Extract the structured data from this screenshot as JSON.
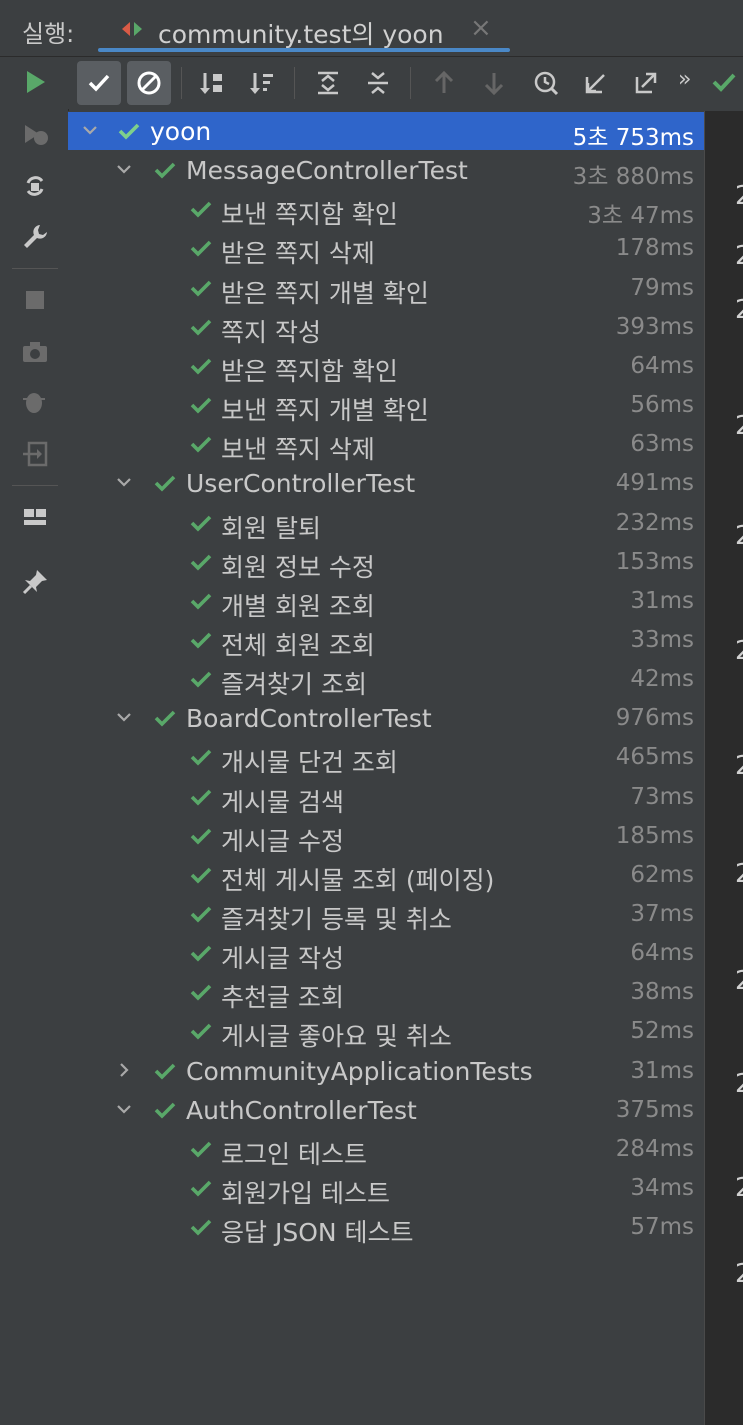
{
  "header": {
    "run_label": "실행:",
    "tab_title": "community.test의 yoon",
    "tab_close": "×"
  },
  "toolbar": {
    "more": "»"
  },
  "tree": {
    "root": {
      "label": "yoon",
      "time": "5초 753ms"
    },
    "suites": [
      {
        "label": "MessageControllerTest",
        "time": "3초 880ms",
        "expanded": true,
        "tests": [
          {
            "label": "보낸 쪽지함 확인",
            "time": "3초 47ms"
          },
          {
            "label": "받은 쪽지 삭제",
            "time": "178ms"
          },
          {
            "label": "받은 쪽지 개별 확인",
            "time": "79ms"
          },
          {
            "label": "쪽지 작성",
            "time": "393ms"
          },
          {
            "label": "받은 쪽지함 확인",
            "time": "64ms"
          },
          {
            "label": "보낸 쪽지 개별 확인",
            "time": "56ms"
          },
          {
            "label": "보낸 쪽지 삭제",
            "time": "63ms"
          }
        ]
      },
      {
        "label": "UserControllerTest",
        "time": "491ms",
        "expanded": true,
        "tests": [
          {
            "label": "회원 탈퇴",
            "time": "232ms"
          },
          {
            "label": "회원 정보 수정",
            "time": "153ms"
          },
          {
            "label": "개별 회원 조회",
            "time": "31ms"
          },
          {
            "label": "전체 회원 조회",
            "time": "33ms"
          },
          {
            "label": "즐겨찾기 조회",
            "time": "42ms"
          }
        ]
      },
      {
        "label": "BoardControllerTest",
        "time": "976ms",
        "expanded": true,
        "tests": [
          {
            "label": "개시물 단건 조회",
            "time": "465ms"
          },
          {
            "label": "게시물 검색",
            "time": "73ms"
          },
          {
            "label": "게시글 수정",
            "time": "185ms"
          },
          {
            "label": "전체 게시물 조회 (페이징)",
            "time": "62ms"
          },
          {
            "label": "즐겨찾기 등록 및 취소",
            "time": "37ms"
          },
          {
            "label": "게시글 작성",
            "time": "64ms"
          },
          {
            "label": "추천글 조회",
            "time": "38ms"
          },
          {
            "label": "게시글 좋아요 및 취소",
            "time": "52ms"
          }
        ]
      },
      {
        "label": "CommunityApplicationTests",
        "time": "31ms",
        "expanded": false,
        "tests": []
      },
      {
        "label": "AuthControllerTest",
        "time": "375ms",
        "expanded": true,
        "tests": [
          {
            "label": "로그인 테스트",
            "time": "284ms"
          },
          {
            "label": "회원가입 테스트",
            "time": "34ms"
          },
          {
            "label": "응답 JSON 테스트",
            "time": "57ms"
          }
        ]
      }
    ]
  },
  "console_lines": [
    "2",
    "2",
    "2",
    "2",
    "2",
    "2",
    "2",
    "2",
    "2",
    "2",
    "2",
    "2"
  ],
  "colors": {
    "accent": "#2f65ca",
    "check": "#59a869",
    "tab_underline": "#4a88c7",
    "run": "#59a869"
  }
}
